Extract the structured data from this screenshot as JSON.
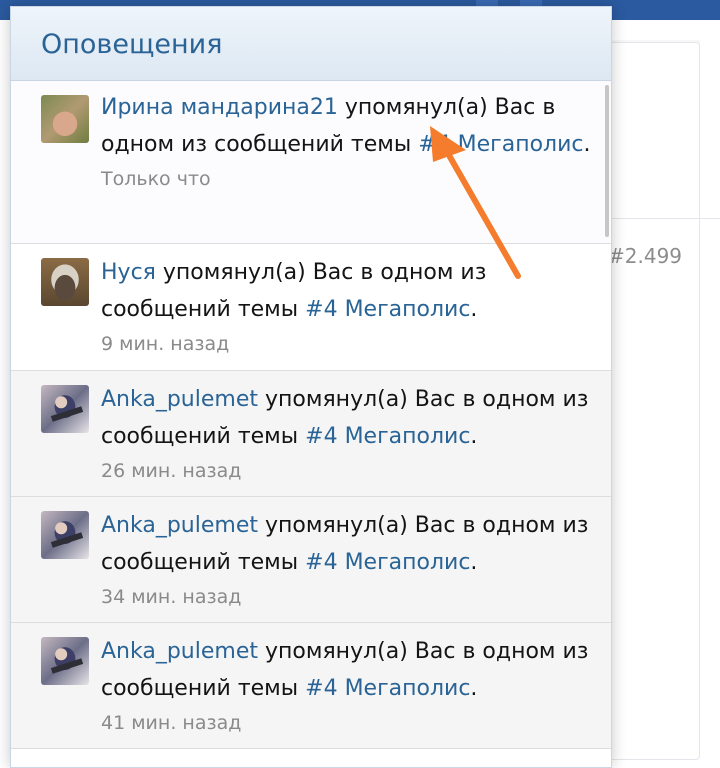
{
  "background": {
    "post_number": "#2.499"
  },
  "popup": {
    "title": "Оповещения"
  },
  "notifications": [
    {
      "user": "Ирина мандарина21",
      "avatar": "avatar-irina",
      "action": "упомянул(а) Вас в одном из сообщений темы",
      "topic": "#4 Мегаполис",
      "after": ".",
      "time": "Только что",
      "unread": true
    },
    {
      "user": "Нуся",
      "avatar": "avatar-nusya",
      "action": "упомянул(а) Вас в одном из сообщений темы",
      "topic": "#4 Мегаполис",
      "after": ".",
      "time": "9 мин. назад",
      "unread": false
    },
    {
      "user": "Anka_pulemet",
      "avatar": "avatar-anka",
      "action": "упомянул(а) Вас в одном из сообщений темы",
      "topic": "#4 Мегаполис",
      "after": ".",
      "time": "26 мин. назад",
      "unread": false
    },
    {
      "user": "Anka_pulemet",
      "avatar": "avatar-anka",
      "action": "упомянул(а) Вас в одном из сообщений темы",
      "topic": "#4 Мегаполис",
      "after": ".",
      "time": "34 мин. назад",
      "unread": false
    },
    {
      "user": "Anka_pulemet",
      "avatar": "avatar-anka",
      "action": "упомянул(а) Вас в одном из сообщений темы",
      "topic": "#4 Мегаполис",
      "after": ".",
      "time": "41 мин. назад",
      "unread": false
    }
  ],
  "annotation": {
    "arrow_color": "#f47c2c"
  },
  "colors": {
    "link": "#2a6496",
    "header_bar": "#2b5aa0",
    "time": "#8a8a8a"
  }
}
